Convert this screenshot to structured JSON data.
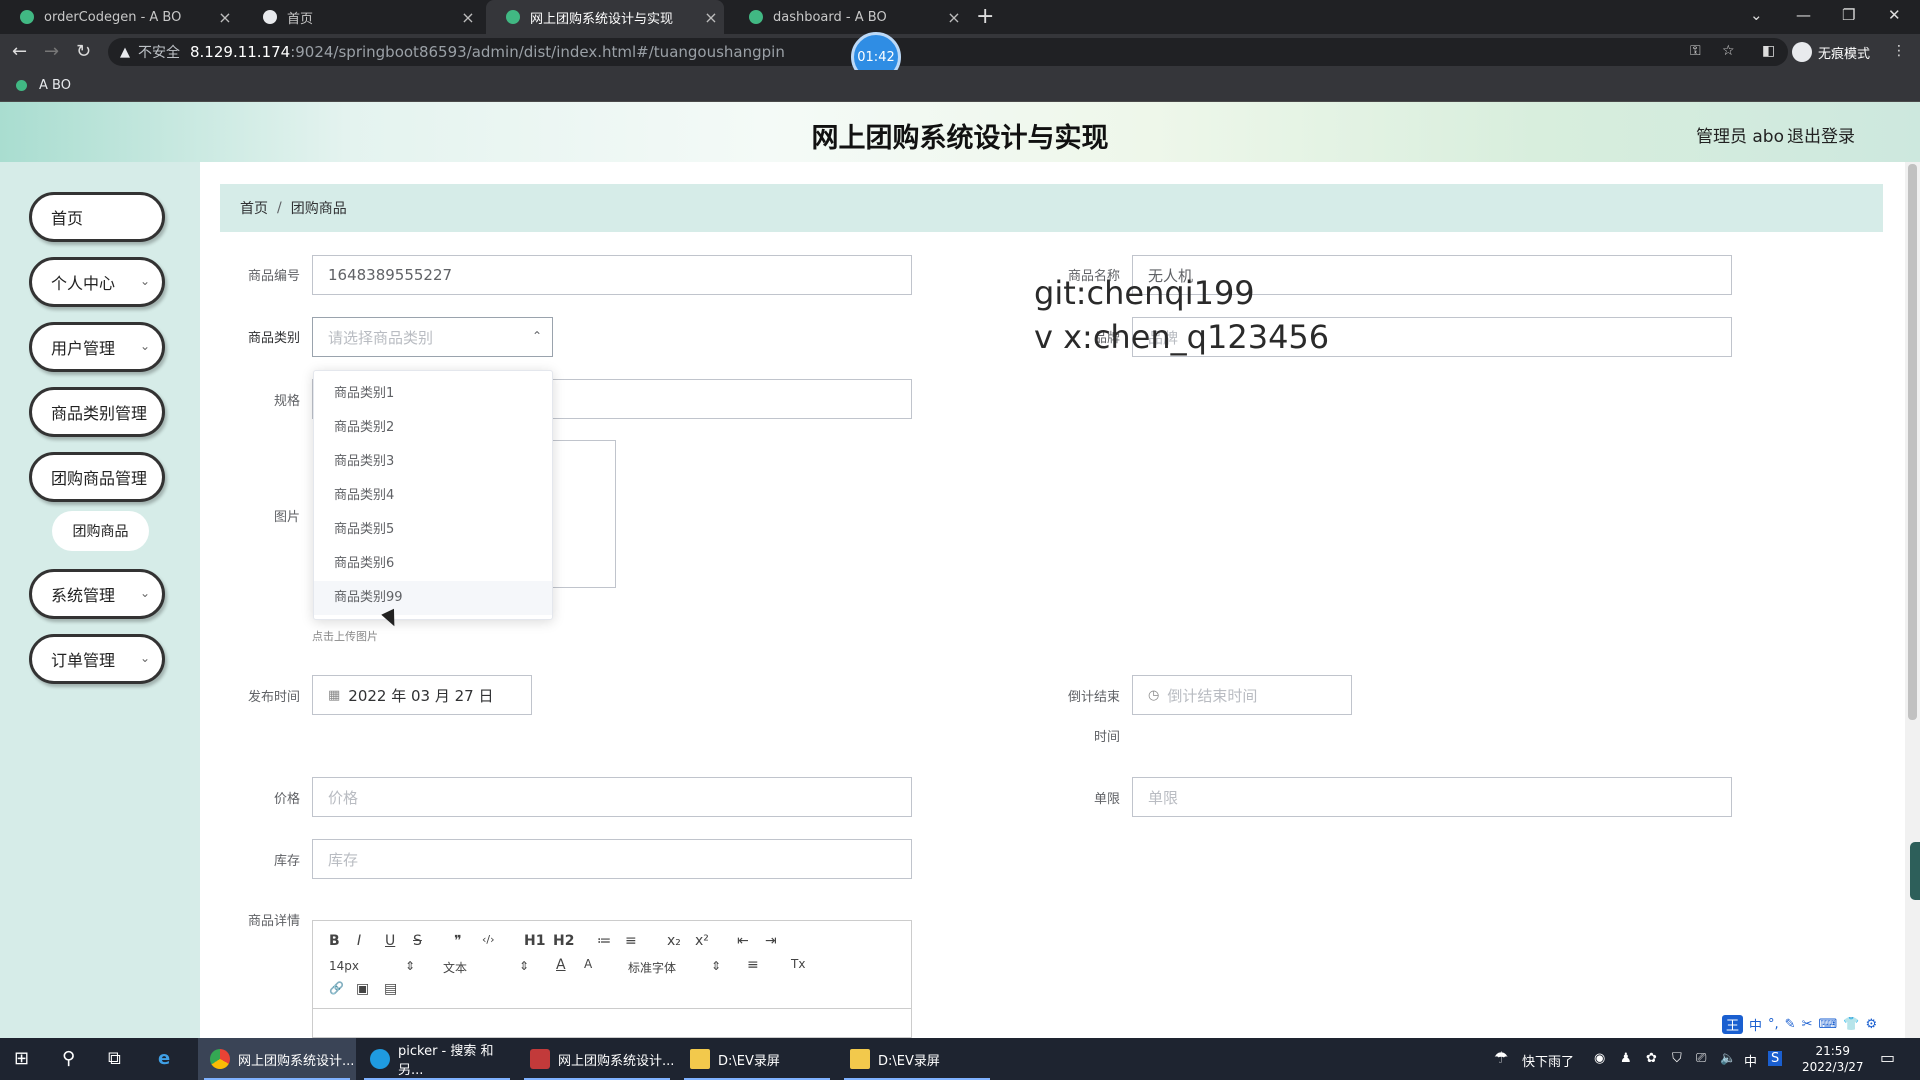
{
  "browser": {
    "tabs": [
      {
        "label": "orderCodegen - A BO"
      },
      {
        "label": "首页"
      },
      {
        "label": "网上团购系统设计与实现"
      },
      {
        "label": "dashboard - A BO"
      }
    ],
    "security_label": "不安全",
    "url_host": "8.129.11.174",
    "url_rest": ":9024/springboot86593/admin/dist/index.html#/tuangoushangpin",
    "incognito_label": "无痕模式",
    "bookmark": "A BO",
    "timer": "01:42"
  },
  "app": {
    "title": "网上团购系统设计与实现",
    "admin": "管理员 abo",
    "logout": "退出登录"
  },
  "sidebar": {
    "items": [
      {
        "label": "首页"
      },
      {
        "label": "个人中心"
      },
      {
        "label": "用户管理"
      },
      {
        "label": "商品类别管理"
      },
      {
        "label": "团购商品管理"
      },
      {
        "label": "团购商品"
      },
      {
        "label": "系统管理"
      },
      {
        "label": "订单管理"
      }
    ]
  },
  "breadcrumb": {
    "home": "首页",
    "sep": "/",
    "current": "团购商品"
  },
  "form": {
    "code_label": "商品编号",
    "code_value": "1648389555227",
    "name_label": "商品名称",
    "name_value": "无人机",
    "category_label": "商品类别",
    "category_placeholder": "请选择商品类别",
    "brand_label": "品牌",
    "brand_placeholder": "品牌",
    "spec_label": "规格",
    "image_label": "图片",
    "upload_tip": "点击上传图片",
    "publish_label": "发布时间",
    "publish_value": "2022 年 03 月 27 日",
    "countdown_label_1": "倒计结束",
    "countdown_label_2": "时间",
    "countdown_placeholder": "倒计结束时间",
    "price_label": "价格",
    "price_placeholder": "价格",
    "limit_label": "单限",
    "limit_placeholder": "单限",
    "stock_label": "库存",
    "stock_placeholder": "库存",
    "detail_label": "商品详情"
  },
  "dropdown": {
    "options": [
      "商品类别1",
      "商品类别2",
      "商品类别3",
      "商品类别4",
      "商品类别5",
      "商品类别6",
      "商品类别99"
    ]
  },
  "watermark": {
    "line1": "git:chenqi199",
    "line2": "v x:chen_q123456"
  },
  "editor": {
    "font_size": "14px",
    "block_format": "文本",
    "font_family": "标准字体",
    "buttons": {
      "bold": "B",
      "italic": "I",
      "underline": "U",
      "strike": "S",
      "quote": "❞",
      "code": "‹/›",
      "h1": "H1",
      "h2": "H2",
      "ol": "≔",
      "ul": "≡",
      "sub": "x₂",
      "sup": "x²",
      "outdent": "⇤",
      "indent": "⇥",
      "color": "A",
      "bg": "A",
      "align": "≡",
      "clean": "Tx",
      "link": "🔗",
      "image": "▣",
      "video": "▤"
    }
  },
  "ime": {
    "logo": "王",
    "mode": "中"
  },
  "taskbar": {
    "items": [
      {
        "label": "网上团购系统设计..."
      },
      {
        "label": "picker - 搜索 和另..."
      },
      {
        "label": "网上团购系统设计..."
      },
      {
        "label": "D:\\EV录屏"
      },
      {
        "label": "D:\\EV录屏"
      }
    ],
    "weather": "快下雨了",
    "ime_indicator": "中",
    "time": "21:59",
    "date": "2022/3/27"
  },
  "colors": {
    "sidebar_bg": "#d6ece8",
    "breadcrumb_bg": "#d6ece8",
    "taskbar_bg": "#1e2430",
    "browser_dark": "#35363a"
  }
}
